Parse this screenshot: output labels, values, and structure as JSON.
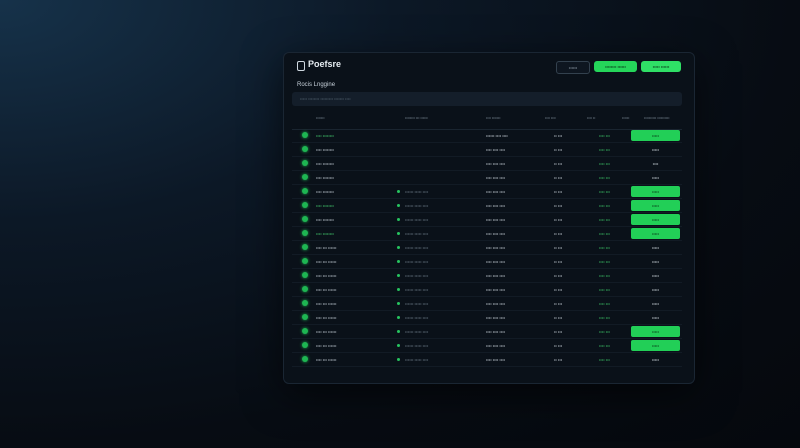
{
  "app": {
    "title": "Poefsre",
    "actions": [
      "••••••",
      "•••••••• ••••••",
      "••••• ••••••"
    ]
  },
  "section_title": "Rocis Lnggine",
  "filter_placeholder": "••••• •••••••• ••••••••• ••••••• ••••",
  "columns": [
    "•••••••",
    "•••••••• ••• ••••••",
    "•••• •••••••",
    "•••• ••••",
    "•••• ••",
    "••••••",
    "•••••••••• ••••••••••"
  ],
  "rows": [
    {
      "name": "•••• ••••••••",
      "highlight": true,
      "desc": "",
      "date": "•••••• •••• ••••",
      "code": "•• •••",
      "trend": "•••• •••",
      "status": "•••••",
      "status_on": true
    },
    {
      "name": "•••• ••••••••",
      "highlight": false,
      "desc": "",
      "date": "•••• •••• ••••",
      "code": "•• •••",
      "trend": "•••• •••",
      "status": "•••••",
      "status_on": false
    },
    {
      "name": "•••• ••••••••",
      "highlight": false,
      "desc": "",
      "date": "•••• •••• ••••",
      "code": "•• •••",
      "trend": "•••• •••",
      "status": "••••",
      "status_on": false
    },
    {
      "name": "•••• ••••••••",
      "highlight": false,
      "desc": "",
      "date": "•••• •••• ••••",
      "code": "•• •••",
      "trend": "•••• •••",
      "status": "•••••",
      "status_on": false
    },
    {
      "name": "•••• ••••••••",
      "highlight": false,
      "desc": "•••••• ••••• ••••",
      "date": "•••• •••• ••••",
      "code": "•• •••",
      "trend": "•••• •••",
      "status": "•••••",
      "status_on": true
    },
    {
      "name": "•••• ••••••••",
      "highlight": true,
      "desc": "•••••• ••••• ••••",
      "date": "•••• •••• ••••",
      "code": "•• •••",
      "trend": "•••• •••",
      "status": "•••••",
      "status_on": true
    },
    {
      "name": "•••• ••••••••",
      "highlight": false,
      "desc": "•••••• ••••• ••••",
      "date": "•••• •••• ••••",
      "code": "•• •••",
      "trend": "•••• •••",
      "status": "•••••",
      "status_on": true
    },
    {
      "name": "•••• ••••••••",
      "highlight": true,
      "desc": "•••••• ••••• ••••",
      "date": "•••• •••• ••••",
      "code": "•• •••",
      "trend": "•••• •••",
      "status": "•••••",
      "status_on": true
    },
    {
      "name": "•••• ••• ••••••",
      "highlight": false,
      "desc": "•••••• ••••• ••••",
      "date": "•••• •••• ••••",
      "code": "•• •••",
      "trend": "•••• •••",
      "status": "•••••",
      "status_on": false
    },
    {
      "name": "•••• ••• ••••••",
      "highlight": false,
      "desc": "•••••• ••••• ••••",
      "date": "•••• •••• ••••",
      "code": "•• •••",
      "trend": "•••• •••",
      "status": "•••••",
      "status_on": false
    },
    {
      "name": "•••• ••• ••••••",
      "highlight": false,
      "desc": "•••••• ••••• ••••",
      "date": "•••• •••• ••••",
      "code": "•• •••",
      "trend": "•••• •••",
      "status": "•••••",
      "status_on": false
    },
    {
      "name": "•••• ••• ••••••",
      "highlight": false,
      "desc": "•••••• ••••• ••••",
      "date": "•••• •••• ••••",
      "code": "•• •••",
      "trend": "•••• •••",
      "status": "•••••",
      "status_on": false
    },
    {
      "name": "•••• ••• ••••••",
      "highlight": false,
      "desc": "•••••• ••••• ••••",
      "date": "•••• •••• ••••",
      "code": "•• •••",
      "trend": "•••• •••",
      "status": "•••••",
      "status_on": false
    },
    {
      "name": "•••• ••• ••••••",
      "highlight": false,
      "desc": "•••••• ••••• ••••",
      "date": "•••• •••• ••••",
      "code": "•• •••",
      "trend": "•••• •••",
      "status": "•••••",
      "status_on": false
    },
    {
      "name": "•••• ••• ••••••",
      "highlight": false,
      "desc": "•••••• ••••• ••••",
      "date": "•••• •••• ••••",
      "code": "•• •••",
      "trend": "•••• •••",
      "status": "•••••",
      "status_on": true
    },
    {
      "name": "•••• ••• ••••••",
      "highlight": false,
      "desc": "•••••• ••••• ••••",
      "date": "•••• •••• ••••",
      "code": "•• •••",
      "trend": "•••• •••",
      "status": "•••••",
      "status_on": true
    },
    {
      "name": "•••• ••• ••••••",
      "highlight": false,
      "desc": "•••••• ••••• ••••",
      "date": "•••• •••• ••••",
      "code": "•• •••",
      "trend": "•••• •••",
      "status": "•••••",
      "status_on": false
    }
  ],
  "colors": {
    "accent_green": "#25d65a",
    "background": "#0a1119",
    "header_bg": "#141e2a"
  }
}
